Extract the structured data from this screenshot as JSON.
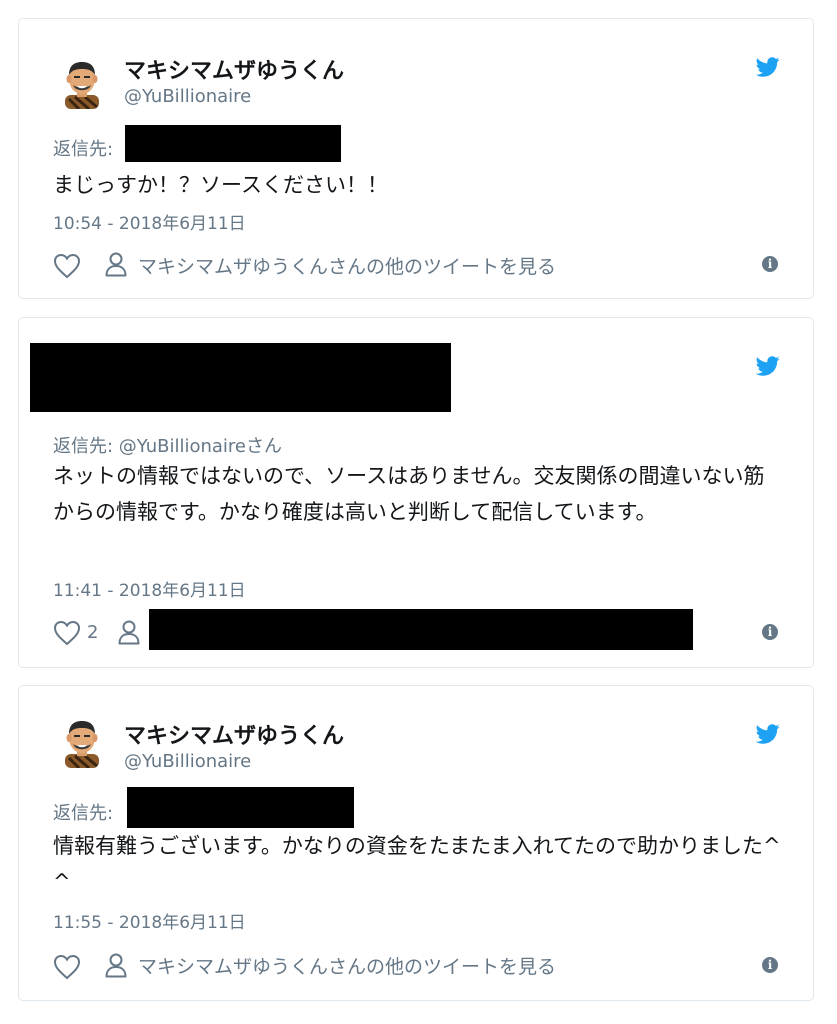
{
  "tweets": [
    {
      "name": "マキシマムザゆうくん",
      "handle": "@YuBillionaire",
      "reply_prefix": "返信先:",
      "text": "まじっすか！？ソースください！！",
      "time": "10:54 - 2018年6月11日",
      "more_link": "マキシマムザゆうくんさんの他のツイートを見る",
      "info_glyph": "i"
    },
    {
      "reply_line": "返信先: @YuBillionaireさん",
      "text": "ネットの情報ではないので、ソースはありません。交友関係の間違いない筋からの情報です。かなり確度は高いと判断して配信しています。",
      "time": "11:41 - 2018年6月11日",
      "like_count": "2",
      "info_glyph": "i"
    },
    {
      "name": "マキシマムザゆうくん",
      "handle": "@YuBillionaire",
      "reply_prefix": "返信先:",
      "text": "情報有難うございます。かなりの資金をたまたま入れてたので助かりました^ ^",
      "time": "11:55 - 2018年6月11日",
      "more_link": "マキシマムザゆうくんさんの他のツイートを見る",
      "info_glyph": "i"
    }
  ],
  "colors": {
    "twitter_blue": "#1da1f2",
    "secondary_text": "#657786",
    "border": "#e1e8ed",
    "redaction": "#000000"
  },
  "icons": [
    "avatar",
    "twitter-bird-icon",
    "heart-icon",
    "person-icon",
    "info-icon"
  ]
}
